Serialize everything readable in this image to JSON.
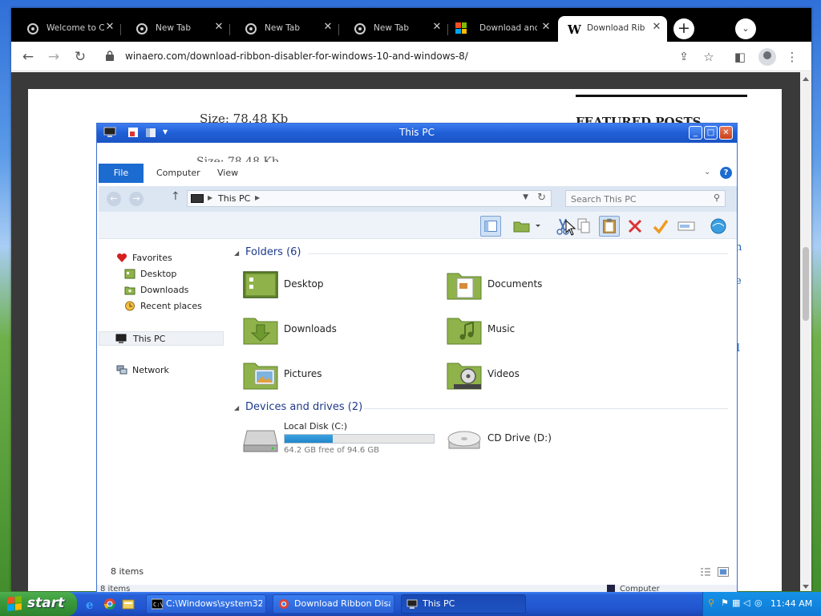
{
  "browser": {
    "tabs": [
      {
        "label": "Welcome to Ch",
        "icon": "chrome-icon"
      },
      {
        "label": "New Tab",
        "icon": "chrome-icon"
      },
      {
        "label": "New Tab",
        "icon": "chrome-icon"
      },
      {
        "label": "New Tab",
        "icon": "chrome-icon"
      },
      {
        "label": "Download and I",
        "icon": "microsoft-icon"
      },
      {
        "label": "Download Ribb",
        "icon": "winaero-icon",
        "active": true
      }
    ],
    "url": "winaero.com/download-ribbon-disabler-for-windows-10-and-windows-8/",
    "winaero_logo": "W"
  },
  "webpage": {
    "size_text": "Size: 78.48 Kb",
    "featured": "FEATURED POSTS"
  },
  "explorer": {
    "title": "This PC",
    "ribbon_tabs": [
      "File",
      "Computer",
      "View"
    ],
    "breadcrumb": "This PC",
    "search_placeholder": "Search This PC",
    "nav": {
      "favorites": "Favorites",
      "desktop": "Desktop",
      "downloads": "Downloads",
      "recent": "Recent places",
      "this_pc": "This PC",
      "network": "Network"
    },
    "folders_header": "Folders (6)",
    "folders": [
      "Desktop",
      "Documents",
      "Downloads",
      "Music",
      "Pictures",
      "Videos"
    ],
    "devices_header": "Devices and drives (2)",
    "drives": {
      "local_name": "Local Disk (C:)",
      "local_free": "64.2 GB free of 94.6 GB",
      "local_used_fraction": 0.32,
      "cd_name": "CD Drive (D:)"
    },
    "status": "8 items",
    "bottom_left": "8 items",
    "bottom_right": "Computer"
  },
  "taskbar": {
    "start": "start",
    "tasks": [
      "C:\\Windows\\system32...",
      "Download Ribbon Disa...",
      "This PC"
    ],
    "clock": "11:44 AM"
  },
  "colors": {
    "accent": "#1c6bd0",
    "xp_blue": "#2155cf",
    "xp_green": "#3a9a3a",
    "folder_green": "#8fb34a"
  }
}
